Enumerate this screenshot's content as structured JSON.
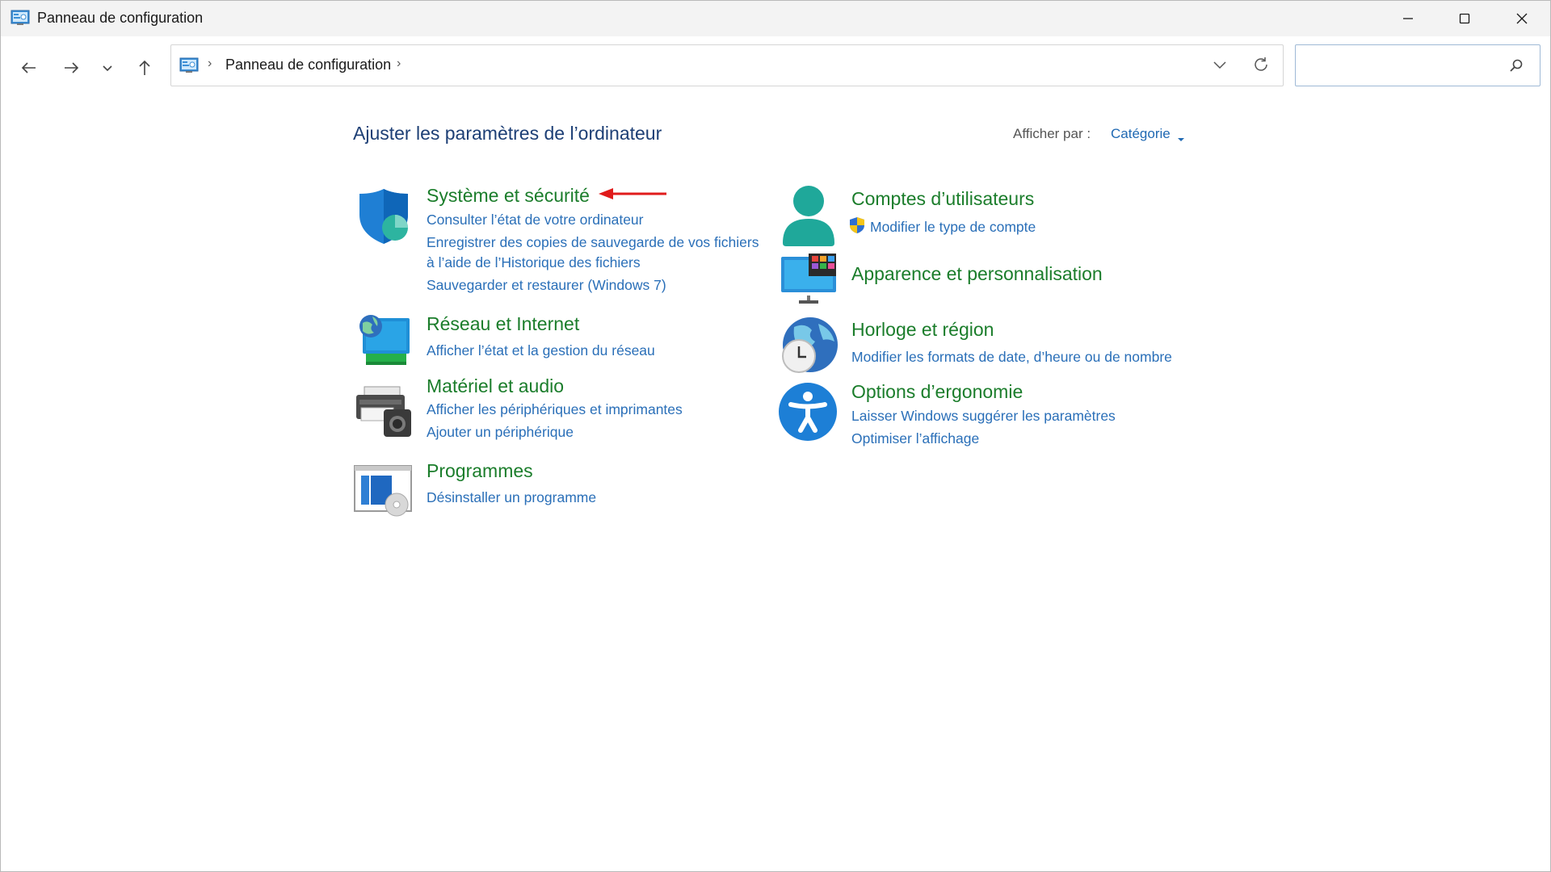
{
  "window": {
    "title": "Panneau de configuration"
  },
  "navigation": {
    "breadcrumb": [
      "Panneau de configuration"
    ],
    "search": {
      "value": "",
      "placeholder": ""
    }
  },
  "main": {
    "heading": "Ajuster les paramètres de l’ordinateur",
    "view_by": {
      "label": "Afficher par :",
      "value": "Catégorie"
    },
    "categories": [
      {
        "title": "Système et sécurité",
        "icon": "shield-icon",
        "links": [
          "Consulter l’état de votre ordinateur",
          "Enregistrer des copies de sauvegarde de vos fichiers",
          "à l’aide de l’Historique des fichiers",
          "Sauvegarder et restaurer (Windows 7)"
        ]
      },
      {
        "title": "Réseau et Internet",
        "icon": "network-icon",
        "links": [
          "Afficher l’état et la gestion du réseau"
        ]
      },
      {
        "title": "Matériel et audio",
        "icon": "printer-icon",
        "links": [
          "Afficher les périphériques et imprimantes",
          "Ajouter un périphérique"
        ]
      },
      {
        "title": "Programmes",
        "icon": "programs-icon",
        "links": [
          "Désinstaller un programme"
        ]
      },
      {
        "title": "Comptes d’utilisateurs",
        "icon": "user-icon",
        "links": [
          "Modifier le type de compte"
        ]
      },
      {
        "title": "Apparence et personnalisation",
        "icon": "monitor-icon",
        "links": []
      },
      {
        "title": "Horloge et région",
        "icon": "clock-globe-icon",
        "links": [
          "Modifier les formats de date, d’heure ou de nombre"
        ]
      },
      {
        "title": "Options d’ergonomie",
        "icon": "accessibility-icon",
        "links": [
          "Laisser Windows suggérer les paramètres",
          "Optimiser l’affichage"
        ]
      }
    ]
  },
  "colors": {
    "heading": "#1d3f75",
    "category_title": "#1b7d2b",
    "link": "#2a6fb8",
    "annotation_arrow": "#e01b1b"
  }
}
